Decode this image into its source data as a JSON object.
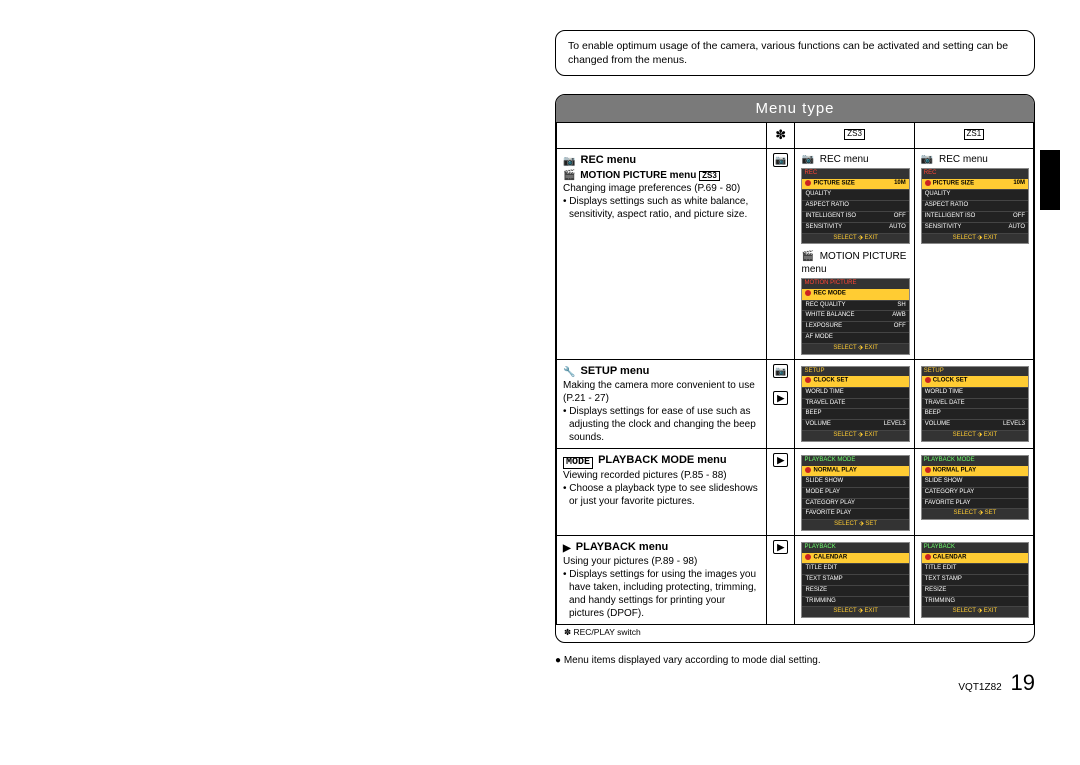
{
  "intro": "To enable optimum usage of the camera, various functions can be activated and setting can be changed from the menus.",
  "section_title": "Menu type",
  "headers": {
    "switch": "✽",
    "model_a": "ZS3",
    "model_b": "ZS1"
  },
  "rows": [
    {
      "head_icon": "camera",
      "head": "REC menu",
      "sub_icon": "movie",
      "sub_head": "MOTION PICTURE menu",
      "sub_badge": "ZS3",
      "desc_line1": "Changing image preferences (P.69 - 80)",
      "bullet": "Displays settings such as white balance, sensitivity, aspect ratio, and picture size.",
      "switch_icon": "camera",
      "zs3_label_icon": "camera",
      "zs3_label": "REC menu",
      "zs3_thumb": {
        "title": "REC",
        "title_style": "red",
        "rows": [
          {
            "l": "PICTURE SIZE",
            "r": "10M",
            "hl": true
          },
          {
            "l": "QUALITY",
            "r": ""
          },
          {
            "l": "ASPECT RATIO",
            "r": ""
          },
          {
            "l": "INTELLIGENT ISO",
            "r": "OFF"
          },
          {
            "l": "SENSITIVITY",
            "r": "AUTO"
          }
        ],
        "foot": "SELECT ⬗ EXIT"
      },
      "zs3_extra_label_icon": "movie",
      "zs3_extra_label": "MOTION PICTURE menu",
      "zs3_extra_thumb": {
        "title": "MOTION PICTURE",
        "title_style": "red",
        "rows": [
          {
            "l": "REC MODE",
            "r": "",
            "hl": true
          },
          {
            "l": "REC QUALITY",
            "r": "SH"
          },
          {
            "l": "WHITE BALANCE",
            "r": "AWB"
          },
          {
            "l": "I.EXPOSURE",
            "r": "OFF"
          },
          {
            "l": "AF MODE",
            "r": ""
          }
        ],
        "foot": "SELECT ⬗ EXIT"
      },
      "zs1_label_icon": "camera",
      "zs1_label": "REC menu",
      "zs1_thumb": {
        "title": "REC",
        "title_style": "red",
        "rows": [
          {
            "l": "PICTURE SIZE",
            "r": "10M",
            "hl": true
          },
          {
            "l": "QUALITY",
            "r": ""
          },
          {
            "l": "ASPECT RATIO",
            "r": ""
          },
          {
            "l": "INTELLIGENT ISO",
            "r": "OFF"
          },
          {
            "l": "SENSITIVITY",
            "r": "AUTO"
          }
        ],
        "foot": "SELECT ⬗ EXIT"
      }
    },
    {
      "head_icon": "wrench",
      "head": "SETUP menu",
      "desc_line1": "Making the camera more convenient to use (P.21 - 27)",
      "bullet": "Displays settings for ease of use such as adjusting the clock and changing the beep sounds.",
      "switch_icon_dual": true,
      "zs3_thumb": {
        "title": "SETUP",
        "title_style": "",
        "rows": [
          {
            "l": "CLOCK SET",
            "r": "",
            "hl": true
          },
          {
            "l": "WORLD TIME",
            "r": ""
          },
          {
            "l": "TRAVEL DATE",
            "r": ""
          },
          {
            "l": "BEEP",
            "r": ""
          },
          {
            "l": "VOLUME",
            "r": "LEVEL3"
          }
        ],
        "foot": "SELECT ⬗ EXIT"
      },
      "zs1_thumb": {
        "title": "SETUP",
        "title_style": "",
        "rows": [
          {
            "l": "CLOCK SET",
            "r": "",
            "hl": true
          },
          {
            "l": "WORLD TIME",
            "r": ""
          },
          {
            "l": "TRAVEL DATE",
            "r": ""
          },
          {
            "l": "BEEP",
            "r": ""
          },
          {
            "l": "VOLUME",
            "r": "LEVEL3"
          }
        ],
        "foot": "SELECT ⬗ EXIT"
      }
    },
    {
      "head_icon": "mode",
      "head_icon_text": "MODE",
      "head": "PLAYBACK MODE menu",
      "desc_line1": "Viewing recorded pictures (P.85 - 88)",
      "bullet": "Choose a playback type to see slideshows or just your favorite pictures.",
      "switch_icon": "play",
      "zs3_thumb": {
        "title": "PLAYBACK MODE",
        "title_style": "green",
        "rows": [
          {
            "l": "NORMAL PLAY",
            "r": "",
            "hl": true
          },
          {
            "l": "SLIDE SHOW",
            "r": ""
          },
          {
            "l": "MODE PLAY",
            "r": ""
          },
          {
            "l": "CATEGORY PLAY",
            "r": ""
          },
          {
            "l": "FAVORITE PLAY",
            "r": ""
          }
        ],
        "foot": "SELECT ⬗ SET"
      },
      "zs1_thumb": {
        "title": "PLAYBACK MODE",
        "title_style": "green",
        "rows": [
          {
            "l": "NORMAL PLAY",
            "r": "",
            "hl": true
          },
          {
            "l": "SLIDE SHOW",
            "r": ""
          },
          {
            "l": "CATEGORY PLAY",
            "r": ""
          },
          {
            "l": "FAVORITE PLAY",
            "r": ""
          }
        ],
        "foot": "SELECT ⬗ SET"
      }
    },
    {
      "head_icon": "play",
      "head": "PLAYBACK menu",
      "desc_line1": "Using your pictures (P.89 - 98)",
      "bullet": "Displays settings for using the images you have taken, including protecting, trimming, and handy settings for printing your pictures (DPOF).",
      "switch_icon": "play",
      "zs3_thumb": {
        "title": "PLAYBACK",
        "title_style": "green",
        "rows": [
          {
            "l": "CALENDAR",
            "r": "",
            "hl": true
          },
          {
            "l": "TITLE EDIT",
            "r": ""
          },
          {
            "l": "TEXT STAMP",
            "r": ""
          },
          {
            "l": "RESIZE",
            "r": ""
          },
          {
            "l": "TRIMMING",
            "r": ""
          }
        ],
        "foot": "SELECT ⬗ EXIT"
      },
      "zs1_thumb": {
        "title": "PLAYBACK",
        "title_style": "green",
        "rows": [
          {
            "l": "CALENDAR",
            "r": "",
            "hl": true
          },
          {
            "l": "TITLE EDIT",
            "r": ""
          },
          {
            "l": "TEXT STAMP",
            "r": ""
          },
          {
            "l": "RESIZE",
            "r": ""
          },
          {
            "l": "TRIMMING",
            "r": ""
          }
        ],
        "foot": "SELECT ⬗ EXIT"
      }
    }
  ],
  "table_footnote": "✽ REC/PLAY switch",
  "note_below": "● Menu items displayed vary according to mode dial setting.",
  "footer_code": "VQT1Z82",
  "page_number": "19"
}
